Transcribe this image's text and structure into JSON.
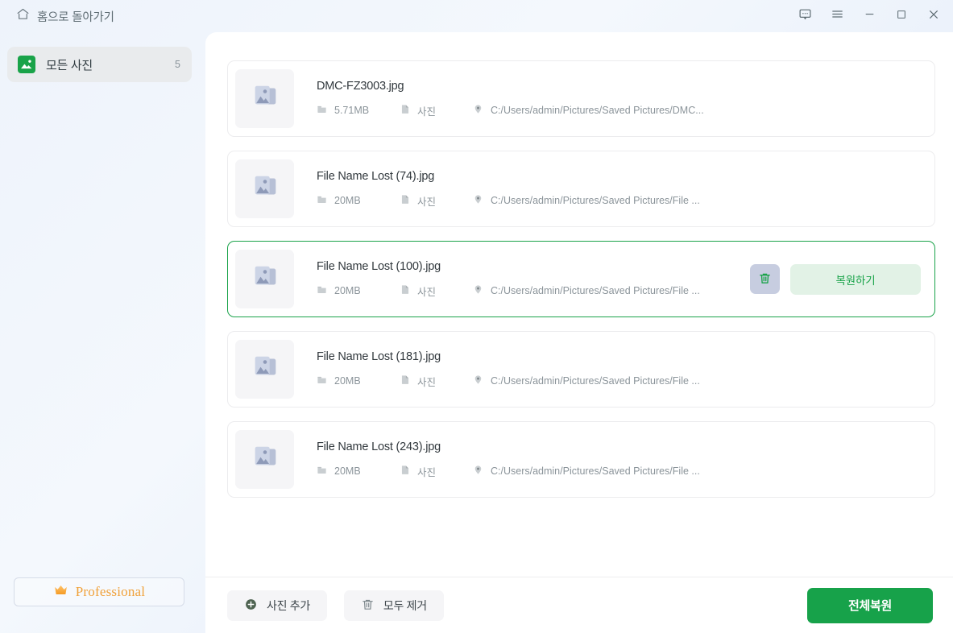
{
  "titlebar": {
    "home_label": "홈으로 돌아가기",
    "home_icon": "home-icon",
    "controls": [
      {
        "name": "feedback-button",
        "icon": "chat-bubble-icon"
      },
      {
        "name": "menu-button",
        "icon": "hamburger-menu-icon"
      },
      {
        "name": "minimize-button",
        "icon": "minimize-icon"
      },
      {
        "name": "maximize-button",
        "icon": "maximize-icon"
      },
      {
        "name": "close-button",
        "icon": "close-icon"
      }
    ]
  },
  "sidebar": {
    "item": {
      "label": "모든 사진",
      "count": "5",
      "icon": "photo-icon"
    },
    "pro_button": {
      "label": "Professional",
      "icon": "crown-icon",
      "color": "#f0a13a"
    }
  },
  "main": {
    "files": [
      {
        "name": "DMC-FZ3003.jpg",
        "size": "5.71MB",
        "type": "사진",
        "path": "C:/Users/admin/Pictures/Saved Pictures/DMC...",
        "selected": false
      },
      {
        "name": "File Name Lost (74).jpg",
        "size": "20MB",
        "type": "사진",
        "path": "C:/Users/admin/Pictures/Saved Pictures/File ...",
        "selected": false
      },
      {
        "name": "File Name Lost (100).jpg",
        "size": "20MB",
        "type": "사진",
        "path": "C:/Users/admin/Pictures/Saved Pictures/File ...",
        "selected": true
      },
      {
        "name": "File Name Lost (181).jpg",
        "size": "20MB",
        "type": "사진",
        "path": "C:/Users/admin/Pictures/Saved Pictures/File ...",
        "selected": false
      },
      {
        "name": "File Name Lost (243).jpg",
        "size": "20MB",
        "type": "사진",
        "path": "C:/Users/admin/Pictures/Saved Pictures/File ...",
        "selected": false
      }
    ],
    "row_actions": {
      "delete_icon": "trash-icon",
      "restore_label": "복원하기"
    },
    "meta_icons": {
      "size_icon": "folder-icon",
      "type_icon": "file-icon",
      "path_icon": "location-pin-icon"
    },
    "thumbnail_icon": "image-placeholder-icon"
  },
  "bottombar": {
    "add_photo_label": "사진 추가",
    "add_photo_icon": "plus-circle-icon",
    "remove_all_label": "모두 제거",
    "remove_all_icon": "trash-icon",
    "restore_all_label": "전체복원"
  },
  "colors": {
    "accent_green": "#17a24a",
    "restore_bg": "#e2f2e6",
    "delete_bg": "#c7cde0",
    "pro_orange": "#f0a13a"
  }
}
